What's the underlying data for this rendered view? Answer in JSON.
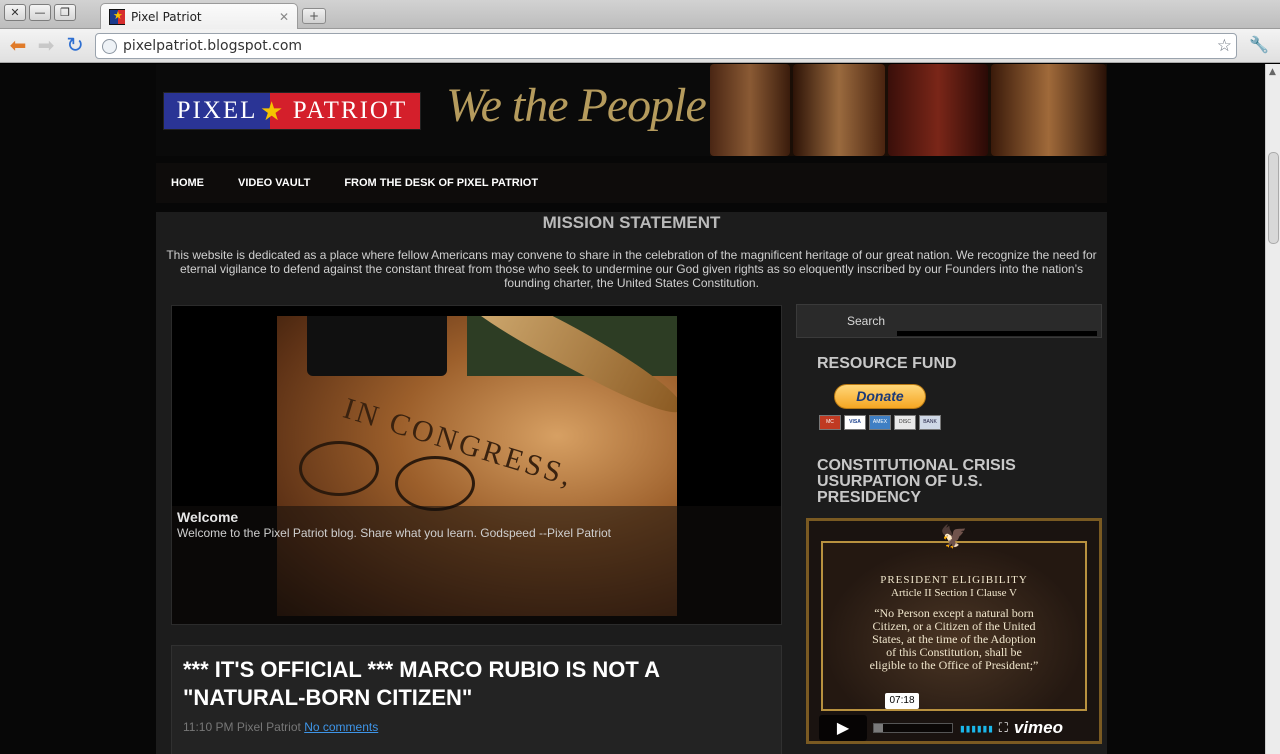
{
  "browser": {
    "window_buttons": [
      "✕",
      "—",
      "❐"
    ],
    "tab_title": "Pixel Patriot",
    "new_tab": "+",
    "url": "pixelpatriot.blogspot.com"
  },
  "header": {
    "logo_left": "PIXEL",
    "logo_right": "PATRIOT",
    "tagline": "We the People"
  },
  "nav": {
    "items": [
      "HOME",
      "VIDEO VAULT",
      "FROM THE DESK OF PIXEL PATRIOT"
    ]
  },
  "mission": {
    "title": "MISSION STATEMENT",
    "text": "This website is dedicated as a place where fellow Americans may convene to share in the celebration of the magnificent heritage of our great nation. We recognize the need for eternal vigilance to defend against the constant threat from those who seek to undermine our God given rights as so eloquently inscribed by our Founders into the nation’s founding charter, the United States Constitution."
  },
  "featured": {
    "image_text": "IN CONGRESS,",
    "title": "Welcome",
    "body": "Welcome to the Pixel Patriot blog. Share what you learn. Godspeed --Pixel Patriot"
  },
  "post": {
    "title": "*** IT'S OFFICIAL *** MARCO RUBIO IS NOT A \"NATURAL-BORN CITIZEN\"",
    "time": "11:10 PM",
    "author": "Pixel Patriot",
    "comments": "No comments"
  },
  "sidebar": {
    "search_label": "Search",
    "resource_fund": "RESOURCE FUND",
    "donate_label": "Donate",
    "cards": [
      "MC",
      "VISA",
      "AMEX",
      "DISC",
      "BANK"
    ],
    "crisis_title": "CONSTITUTIONAL CRISIS USURPATION OF U.S. PRESIDENCY",
    "video": {
      "heading": "PRESIDENT ELIGIBILITY",
      "sub": "Article II  Section I  Clause V",
      "quote": "“No Person except a natural born Citizen, or a Citizen of the United States, at the time of the Adoption of this Constitution, shall be eligible to the Office of President;”",
      "time": "07:18",
      "progress": 0.12,
      "brand": "vimeo"
    }
  },
  "colors": {
    "logo_blue": "#2a3495",
    "logo_red": "#d41f2b",
    "link_blue": "#3e95e8",
    "vimeo_blue": "#1ab7ea"
  }
}
